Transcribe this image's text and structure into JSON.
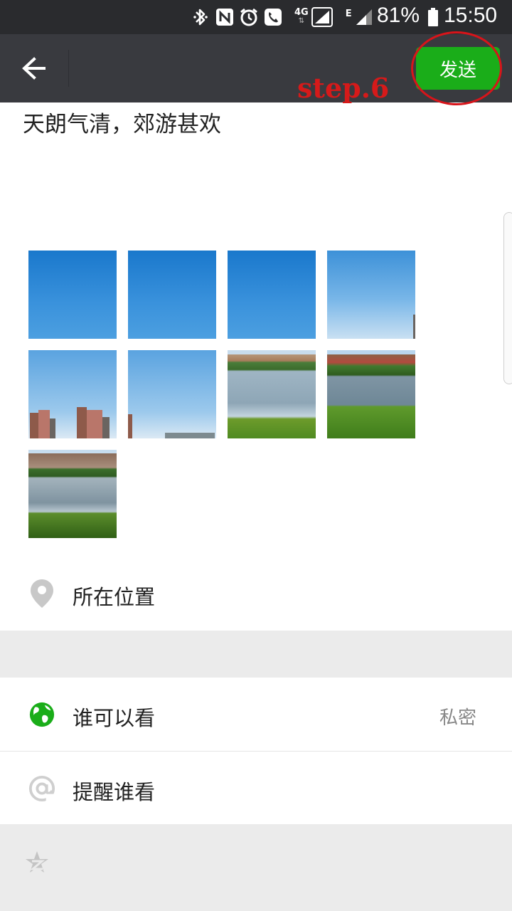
{
  "status_bar": {
    "network": "4G",
    "network_e": "E",
    "battery": "81%",
    "time": "15:50",
    "icons": [
      "bluetooth-icon",
      "nfc-icon",
      "alarm-icon",
      "call-icon",
      "signal-icon",
      "battery-icon"
    ]
  },
  "header": {
    "back_icon": "arrow-left-icon",
    "send_label": "发送",
    "annotation": "step.6",
    "accent": "#1aad19",
    "annotation_color": "#d8141a"
  },
  "post": {
    "text": "天朗气清，郊游甚欢",
    "photo_count": 9
  },
  "location": {
    "icon": "location-pin-icon",
    "label": "所在位置"
  },
  "visibility": {
    "icon": "globe-icon",
    "label": "谁可以看",
    "value": "私密"
  },
  "mention": {
    "icon": "at-icon",
    "label": "提醒谁看"
  },
  "footer": {
    "icon": "qzone-star-icon"
  }
}
